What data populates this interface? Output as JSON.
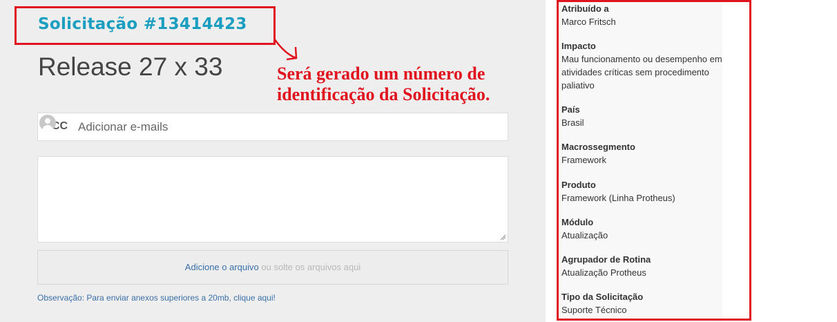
{
  "request": {
    "number_label": "Solicitação #13414423",
    "title": "Release 27 x 33"
  },
  "annotation": {
    "line1": "Será gerado um número de",
    "line2": "identificação da Solicitação."
  },
  "cc": {
    "label": "CC",
    "placeholder": "Adicionar e-mails"
  },
  "dropzone": {
    "link": "Adicione o arquivo",
    "or_text": " ou solte os arquivos aqui"
  },
  "note": "Observação: Para enviar anexos superiores a 20mb, clique aqui!",
  "sidebar": {
    "properties": [
      {
        "label": "Atribuído a",
        "value_lines": [
          "Marco Fritsch"
        ]
      },
      {
        "label": "Impacto",
        "value_lines": [
          "Mau funcionamento ou desempenho em",
          "atividades críticas sem procedimento",
          "paliativo"
        ]
      },
      {
        "label": "País",
        "value_lines": [
          "Brasil"
        ]
      },
      {
        "label": "Macrossegmento",
        "value_lines": [
          "Framework"
        ]
      },
      {
        "label": "Produto",
        "value_lines": [
          "Framework (Linha Protheus)"
        ]
      },
      {
        "label": "Módulo",
        "value_lines": [
          "Atualização"
        ]
      },
      {
        "label": "Agrupador de Rotina",
        "value_lines": [
          "Atualização Protheus"
        ]
      },
      {
        "label": "Tipo da Solicitação",
        "value_lines": [
          "Suporte Técnico"
        ]
      }
    ]
  },
  "colors": {
    "accent": "#1b9ec0",
    "annotation_red": "#e0141e",
    "link_blue": "#3a6fa8"
  }
}
